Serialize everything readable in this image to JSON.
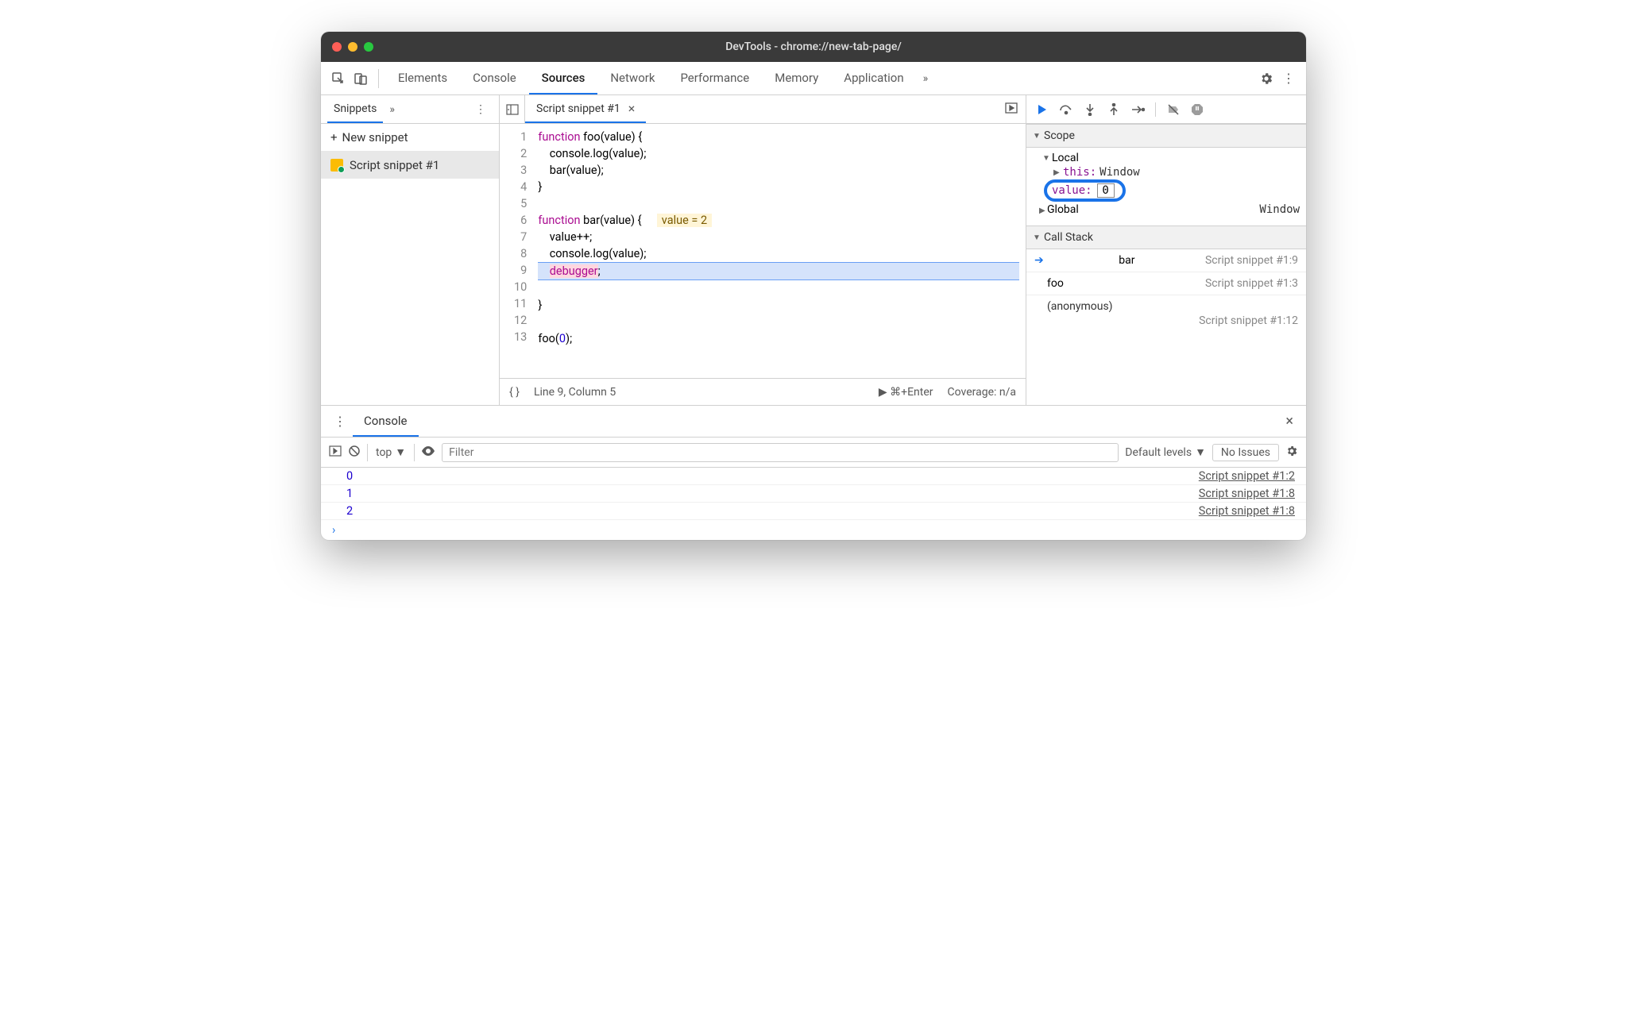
{
  "window": {
    "title": "DevTools - chrome://new-tab-page/"
  },
  "toolbar": {
    "tabs": [
      "Elements",
      "Console",
      "Sources",
      "Network",
      "Performance",
      "Memory",
      "Application"
    ],
    "active": 2
  },
  "sidebar": {
    "tab": "Snippets",
    "new_label": "New snippet",
    "items": [
      {
        "name": "Script snippet #1"
      }
    ]
  },
  "editor": {
    "file_tab": "Script snippet #1",
    "gutter": [
      "1",
      "2",
      "3",
      "4",
      "5",
      "6",
      "7",
      "8",
      "9",
      "10",
      "11",
      "12",
      "13"
    ],
    "inline_hint": "value = 2",
    "status": {
      "pos": "Line 9, Column 5",
      "run": "⌘+Enter",
      "coverage": "Coverage: n/a"
    }
  },
  "debug": {
    "scope_label": "Scope",
    "local_label": "Local",
    "this_label": "this:",
    "this_value": "Window",
    "value_label": "value:",
    "value_edit": "0",
    "global_label": "Global",
    "global_value": "Window",
    "callstack_label": "Call Stack",
    "stack": [
      {
        "fn": "bar",
        "loc": "Script snippet #1:9",
        "current": true
      },
      {
        "fn": "foo",
        "loc": "Script snippet #1:3",
        "current": false
      }
    ],
    "anon": "(anonymous)",
    "anon_loc": "Script snippet #1:12"
  },
  "drawer": {
    "tab": "Console",
    "context": "top",
    "filter_placeholder": "Filter",
    "levels": "Default levels",
    "issues": "No Issues",
    "logs": [
      {
        "v": "0",
        "src": "Script snippet #1:2"
      },
      {
        "v": "1",
        "src": "Script snippet #1:8"
      },
      {
        "v": "2",
        "src": "Script snippet #1:8"
      }
    ]
  }
}
